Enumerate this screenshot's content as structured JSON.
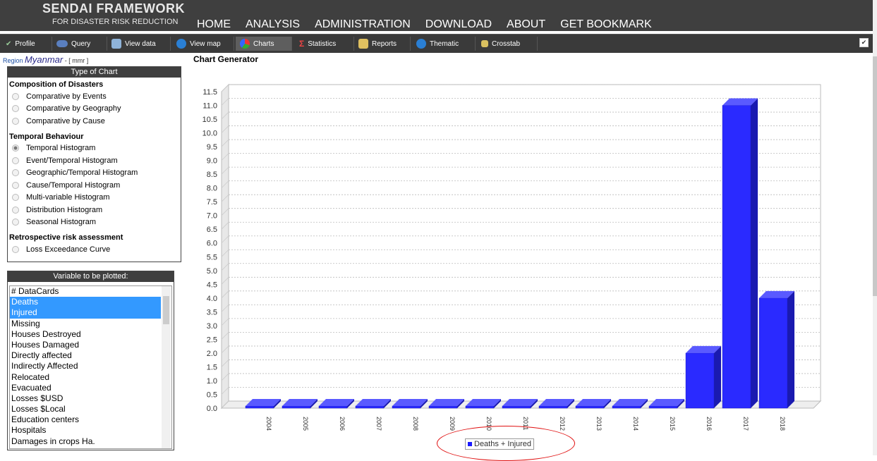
{
  "header": {
    "brand_line1": "SENDAI FRAMEWORK",
    "brand_line2": "FOR DISASTER RISK REDUCTION",
    "nav": [
      "HOME",
      "ANALYSIS",
      "ADMINISTRATION",
      "DOWNLOAD",
      "ABOUT",
      "GET BOOKMARK"
    ]
  },
  "toolbar": {
    "items": [
      "Profile",
      "Query",
      "View data",
      "View map",
      "Charts",
      "Statistics",
      "Reports",
      "Thematic",
      "Crosstab"
    ],
    "active": "Charts",
    "corner_check": "✔"
  },
  "region": {
    "label": "Region",
    "name": "Myanmar",
    "code": "- [ mmr ]"
  },
  "chart_type_panel": {
    "title": "Type of Chart",
    "sections": [
      {
        "heading": "Composition of Disasters",
        "options": [
          "Comparative by Events",
          "Comparative by Geography",
          "Comparative by Cause"
        ]
      },
      {
        "heading": "Temporal Behaviour",
        "options": [
          "Temporal Histogram",
          "Event/Temporal Histogram",
          "Geographic/Temporal Histogram",
          "Cause/Temporal Histogram",
          "Multi-variable Histogram",
          "Distribution Histogram",
          "Seasonal Histogram"
        ]
      },
      {
        "heading": "Retrospective risk assessment",
        "options": [
          "Loss Exceedance Curve"
        ]
      }
    ],
    "selected": "Temporal Histogram"
  },
  "variable_panel": {
    "title": "Variable to be plotted:",
    "items": [
      "# DataCards",
      "Deaths",
      "Injured",
      "Missing",
      "Houses Destroyed",
      "Houses Damaged",
      "Directly affected",
      "Indirectly Affected",
      "Relocated",
      "Evacuated",
      "Losses $USD",
      "Losses $Local",
      "Education centers",
      "Hospitals",
      "Damages in crops Ha."
    ],
    "selected": [
      "Deaths",
      "Injured"
    ]
  },
  "chart_title": "Chart Generator",
  "chart_data": {
    "type": "bar",
    "categories": [
      "2004",
      "2005",
      "2006",
      "2007",
      "2008",
      "2009",
      "2010",
      "2011",
      "2012",
      "2013",
      "2014",
      "2015",
      "2016",
      "2017",
      "2018"
    ],
    "series": [
      {
        "name": "Deaths + Injured",
        "values": [
          0,
          0,
          0,
          0,
          0,
          0,
          0,
          0,
          0,
          0,
          0,
          0,
          2,
          11,
          4
        ]
      }
    ],
    "yticks": [
      "0.0",
      "0.5",
      "1.0",
      "1.5",
      "2.0",
      "2.5",
      "3.0",
      "3.5",
      "4.0",
      "4.5",
      "5.0",
      "5.5",
      "6.0",
      "6.5",
      "7.0",
      "7.5",
      "8.0",
      "8.5",
      "9.0",
      "9.5",
      "10.0",
      "10.5",
      "11.0",
      "11.5"
    ],
    "ylim": [
      0,
      11.5
    ],
    "grid": true,
    "legend": "bottom-center",
    "color": "#3333ff"
  }
}
